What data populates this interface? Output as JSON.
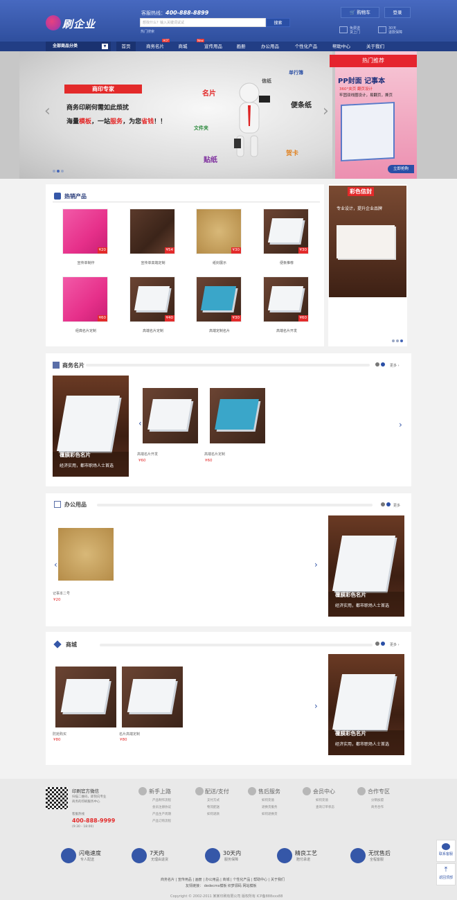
{
  "header": {
    "logo_text": "刷企业",
    "hotline_label": "客服热线：",
    "hotline_number": "400-888-8899",
    "search_placeholder": "想找什么？输入关键词试试",
    "search_button": "搜索",
    "hot_keywords": "热门搜索",
    "cart_label": "购物车",
    "login_label": "登录",
    "service1_line1": "免费送",
    "service1_line2": "货上门",
    "service2_line1": "30天",
    "service2_line2": "退款保障"
  },
  "nav": {
    "category_label": "全部商品分类",
    "items": [
      {
        "label": "首页"
      },
      {
        "label": "商务名片",
        "tag": "HOT"
      },
      {
        "label": "商城"
      },
      {
        "label": "宣传用品",
        "tag": "New"
      },
      {
        "label": "画册"
      },
      {
        "label": "办公用品"
      },
      {
        "label": "个性化产品"
      },
      {
        "label": "帮助中心"
      },
      {
        "label": "关于我们"
      }
    ]
  },
  "banner": {
    "tag": "商印专家",
    "line1": "商务印刷何需如此烦扰",
    "line2_a": "海量",
    "line2_b": "模板",
    "line2_c": "，一站",
    "line2_d": "服务",
    "line2_e": "，为您",
    "line2_f": "省钱",
    "line2_g": "！！",
    "words": [
      "名片",
      "信纸",
      "单行簿",
      "便条纸",
      "文件夹",
      "贴纸",
      "贺卡"
    ]
  },
  "hot_recommend": {
    "ribbon": "热门推荐",
    "title": "PP封面 记事本",
    "sub1": "360°夹页  翻页设计",
    "sub2": "牢固双线圈设计，易翻页，撕页",
    "buy": "立即抢购"
  },
  "hot_products": {
    "title": "热销产品",
    "items": [
      {
        "name": "宣传单制作",
        "price": "¥20"
      },
      {
        "name": "宣传单高端定制",
        "price": "¥54"
      },
      {
        "name": "纸封展示",
        "price": "¥30"
      },
      {
        "name": "便条推荐",
        "price": "¥30"
      },
      {
        "name": "经典名片定制",
        "price": "¥60"
      },
      {
        "name": "高端名片定制",
        "price": "¥40"
      },
      {
        "name": "高端定制名片",
        "price": "¥30"
      },
      {
        "name": "高端名片开发",
        "price": "¥60"
      }
    ],
    "side_title": "彩色信封",
    "side_sub": "专业设计，提升企业品牌"
  },
  "sections": {
    "business_cards": {
      "title": "商务名片",
      "more": "更多",
      "feature_title": "覆膜彩色名片",
      "feature_sub": "经济实用，都市职场人士首选",
      "items": [
        {
          "name": "高端名片开发",
          "price": "¥60"
        },
        {
          "name": "高端名片定制",
          "price": "¥60"
        }
      ]
    },
    "office": {
      "title": "办公用品",
      "more": "更多",
      "items": [
        {
          "name": "记事本二号",
          "price": "¥20"
        }
      ],
      "feature_title": "覆膜彩色名片",
      "feature_sub": "经济实用，都市职场人士首选"
    },
    "mall": {
      "title": "商城",
      "more": "更多",
      "items": [
        {
          "name": "防抢购买",
          "price": "¥80"
        },
        {
          "name": "名片高端定制",
          "price": "¥80"
        }
      ],
      "feature_title": "覆膜彩色名片",
      "feature_sub": "经济实用，都市职场人士首选"
    }
  },
  "footer": {
    "wechat_title": "印刷官方微信",
    "wechat_desc1": "扫描二维码，即刻向专业",
    "wechat_desc2": "商务的印刷服务中心",
    "hotline_label": "客服热线",
    "hotline": "400-888-9999",
    "hours": "(9:30 - 18:00)",
    "columns": [
      {
        "title": "新手上路",
        "items": [
          "产品制作流程",
          "会员注册协议",
          "产品生产周期",
          "产品订购流程"
        ]
      },
      {
        "title": "配送/支付",
        "items": [
          "支付方式",
          "物流配送",
          "如何退款"
        ]
      },
      {
        "title": "售后服务",
        "items": [
          "如何充值",
          "退换货服务",
          "如何退换货"
        ]
      },
      {
        "title": "会员中心",
        "items": [
          "如何充值",
          "查询订单状态"
        ]
      },
      {
        "title": "合作专区",
        "items": [
          "分销加盟",
          "商务合作"
        ]
      }
    ],
    "services": [
      {
        "t1": "闪电速度",
        "t2": "专人配送"
      },
      {
        "t1": "7天内",
        "t2": "无理由退货"
      },
      {
        "t1": "30天内",
        "t2": "服务保障"
      },
      {
        "t1": "精良工艺",
        "t2": "赔付承诺"
      },
      {
        "t1": "无忧售后",
        "t2": "全程客服"
      }
    ],
    "links": "商务名片 | 宣传用品 | 画册 | 办公用品 | 商城 | 个性化产品 | 帮助中心 | 关于我们",
    "friend_links": "友情链接：  dedecms模板  织梦源码  网站模板",
    "copyright": "Copyright © 2002-2011 某某印刷有限公司 版权所有  ICP备888xxx88",
    "side_contact": "联系客服",
    "side_top": "返回顶部"
  }
}
